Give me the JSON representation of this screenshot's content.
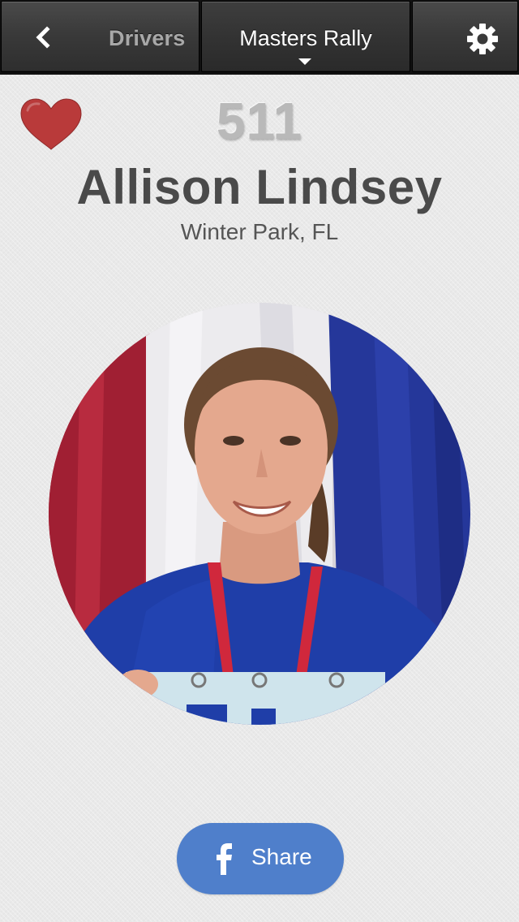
{
  "navbar": {
    "back_label": "Drivers",
    "title": "Masters Rally",
    "back_icon": "chevron-left-icon",
    "settings_icon": "gear-icon",
    "dropdown_icon": "caret-down-icon"
  },
  "driver": {
    "number": "511",
    "name": "Allison Lindsey",
    "location": "Winter Park, FL",
    "favorite": true,
    "favorite_icon": "heart-icon",
    "favorite_color": "#b93a3a"
  },
  "share": {
    "label": "Share",
    "icon": "facebook-icon",
    "color": "#4f7fcb"
  }
}
